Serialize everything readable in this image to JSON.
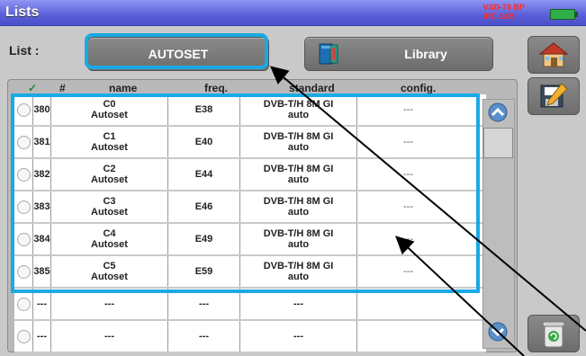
{
  "window": {
    "title": "Lists",
    "status_line1": "VSD-78 BP",
    "status_line2": "IRC  1dB"
  },
  "toolbar": {
    "list_label": "List :",
    "autoset_label": "AUTOSET",
    "library_label": "Library"
  },
  "table": {
    "headers": {
      "select": "",
      "num": "#",
      "name": "name",
      "freq": "freq.",
      "standard": "standard",
      "config": "config."
    },
    "rows": [
      {
        "num": "380",
        "name1": "C0",
        "name2": "Autoset",
        "freq": "E38",
        "std1": "DVB-T/H 8M GI",
        "std2": "auto",
        "config": "---"
      },
      {
        "num": "381",
        "name1": "C1",
        "name2": "Autoset",
        "freq": "E40",
        "std1": "DVB-T/H 8M GI",
        "std2": "auto",
        "config": "---"
      },
      {
        "num": "382",
        "name1": "C2",
        "name2": "Autoset",
        "freq": "E44",
        "std1": "DVB-T/H 8M GI",
        "std2": "auto",
        "config": "---"
      },
      {
        "num": "383",
        "name1": "C3",
        "name2": "Autoset",
        "freq": "E46",
        "std1": "DVB-T/H 8M GI",
        "std2": "auto",
        "config": "---"
      },
      {
        "num": "384",
        "name1": "C4",
        "name2": "Autoset",
        "freq": "E49",
        "std1": "DVB-T/H 8M GI",
        "std2": "auto",
        "config": "---"
      },
      {
        "num": "385",
        "name1": "C5",
        "name2": "Autoset",
        "freq": "E59",
        "std1": "DVB-T/H 8M GI",
        "std2": "auto",
        "config": "---"
      },
      {
        "num": "---",
        "name1": "---",
        "name2": "",
        "freq": "---",
        "std1": "---",
        "std2": "",
        "config": ""
      },
      {
        "num": "---",
        "name1": "---",
        "name2": "",
        "freq": "---",
        "std1": "---",
        "std2": "",
        "config": ""
      }
    ]
  },
  "colors": {
    "highlight": "#19a9e6",
    "titlebar": "#5a5fd8",
    "battery": "#2fb04a"
  },
  "icons": {
    "home": "home-icon",
    "save": "save-edit-icon",
    "trash": "trash-icon",
    "library": "book-icon",
    "scroll_up": "chevron-up-icon",
    "scroll_down": "chevron-down-icon"
  }
}
